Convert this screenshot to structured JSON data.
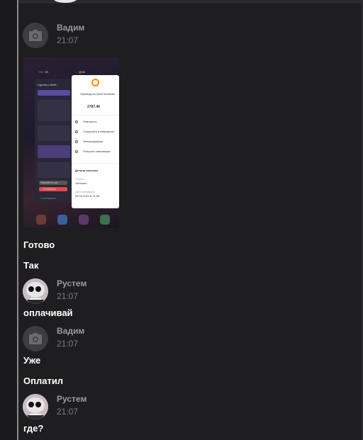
{
  "messages": [
    {
      "type": "header",
      "author": "Вадим",
      "time": "21:07",
      "avatar": "camera-placeholder"
    },
    {
      "type": "header",
      "author": "Рустем",
      "time": "21:07",
      "avatar": "photo"
    },
    {
      "type": "header",
      "author": "Вадим",
      "time": "21:07",
      "avatar": "camera-placeholder"
    },
    {
      "type": "header",
      "author": "Рустем",
      "time": "21:07",
      "avatar": "photo"
    }
  ],
  "texts": {
    "gotovo": "Готово",
    "tak": "Так",
    "oplachivay": "оплачивай",
    "uzhe": "Уже",
    "oplatil": "Оплатил",
    "gde": "где?"
  },
  "attachment": {
    "app_left": "VK",
    "app_right": "QIWI",
    "transfer_title": "Перевод на QIWI Кошелёк",
    "amount": "2787.46",
    "actions": [
      "Повторить",
      "Сохранить в избранное",
      "Запланировать",
      "Получить квитанцию"
    ],
    "details_title": "Детали платежа",
    "status_label": "Статус",
    "status_value": "Успешно",
    "date_label": "Дата операции",
    "date_value": "05.02.2022 в 21:06",
    "chat_name": "Сделка с ВАМ...",
    "chat_input_placeholder": "Сообщение",
    "pay_button": "Перейти к оп...",
    "cancel_button": "Отменить"
  },
  "colors": {
    "background": "#1e1e20",
    "author": "#9a9aa0",
    "time": "#7d7d82",
    "text": "#ffffff",
    "qiwi_orange": "#ff8c00"
  }
}
